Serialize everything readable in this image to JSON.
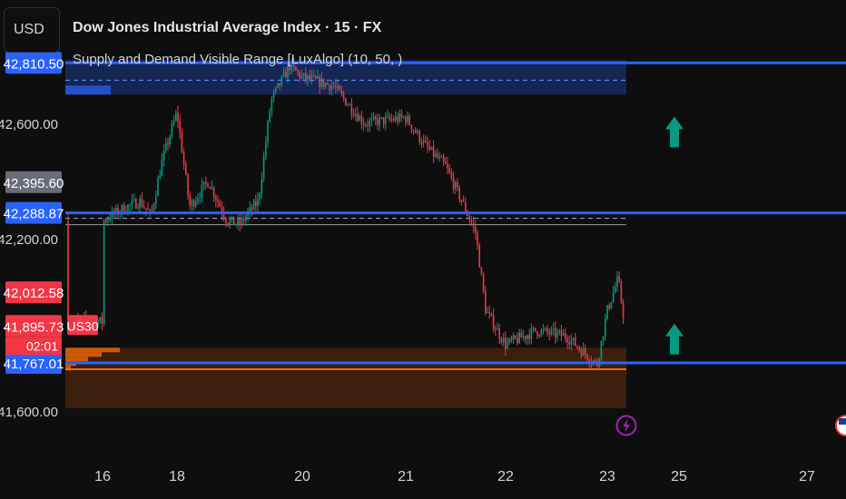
{
  "header": {
    "currency": "USD",
    "title": "Dow Jones Industrial Average Index · 15 · FX",
    "indicator": "Supply and Demand Visible Range [LuxAlgo] (10, 50, )"
  },
  "symbol_tag": "US30",
  "countdown": "02:01",
  "price_tags": [
    {
      "value": 42810.5,
      "label": "42,810.50",
      "color": "#2962ff"
    },
    {
      "value": 42395.6,
      "label": "42,395.60",
      "color": "#6a6d78"
    },
    {
      "value": 42288.87,
      "label": "42,288.87",
      "color": "#2962ff"
    },
    {
      "value": 42012.58,
      "label": "42,012.58",
      "color": "#f23645"
    },
    {
      "value": 41895.73,
      "label": "41,895.73",
      "color": "#f23645"
    },
    {
      "value": 41767.01,
      "label": "41,767.01",
      "color": "#2962ff"
    }
  ],
  "colors": {
    "background": "#0e0e0e",
    "up": "#089981",
    "down": "#f23645",
    "level": "#2962ff",
    "supply_zone": "#1e3a8a",
    "demand_zone": "#5c2a0e",
    "demand_line": "#ff6d00",
    "arrow": "#089981",
    "event_icon": "#9c27b0"
  },
  "icons": [
    "lightning-event-icon",
    "us-flag-icon",
    "up-arrow-icon"
  ],
  "chart_data": {
    "type": "candlestick",
    "x_ticks": [
      "16",
      "18",
      "20",
      "21",
      "22",
      "23",
      "25",
      "27"
    ],
    "y_ticks": [
      42600,
      42200,
      41600
    ],
    "y_tick_labels": [
      "42,600.00",
      "42,200.00",
      "41,600.00"
    ],
    "ylim": [
      41530,
      42880
    ],
    "close_path": [
      [
        "16",
        42260
      ],
      [
        "16.5",
        42300
      ],
      [
        "17",
        42330
      ],
      [
        "17.3",
        42280
      ],
      [
        "17.6",
        42470
      ],
      [
        "18",
        42640
      ],
      [
        "18.2",
        42310
      ],
      [
        "18.5",
        42400
      ],
      [
        "18.8",
        42260
      ],
      [
        "19",
        42250
      ],
      [
        "19.3",
        42330
      ],
      [
        "19.5",
        42680
      ],
      [
        "19.8",
        42800
      ],
      [
        "20",
        42760
      ],
      [
        "20.3",
        42730
      ],
      [
        "20.6",
        42600
      ],
      [
        "21",
        42620
      ],
      [
        "21.2",
        42520
      ],
      [
        "21.4",
        42450
      ],
      [
        "21.6",
        42300
      ],
      [
        "21.7",
        42220
      ],
      [
        "21.8",
        41950
      ],
      [
        "22",
        41830
      ],
      [
        "22.3",
        41880
      ],
      [
        "22.6",
        41860
      ],
      [
        "22.9",
        41760
      ],
      [
        "23",
        41950
      ],
      [
        "23.3",
        42060
      ],
      [
        "23.5",
        41890
      ],
      [
        "23.7",
        41880
      ],
      [
        "23.9",
        41870
      ],
      [
        "24",
        41910
      ]
    ],
    "zones": [
      {
        "type": "supply",
        "top": 42820,
        "bottom": 42700,
        "avg": 42750
      },
      {
        "type": "demand",
        "top": 41820,
        "bottom": 41610,
        "avg": 41768
      }
    ],
    "levels": [
      42810.5,
      42288.87,
      41767.01
    ],
    "dashed_levels": [
      42270
    ],
    "signals": [
      {
        "x": "25",
        "price": 42580,
        "direction": "up"
      },
      {
        "x": "25",
        "price": 41860,
        "direction": "up"
      }
    ]
  }
}
